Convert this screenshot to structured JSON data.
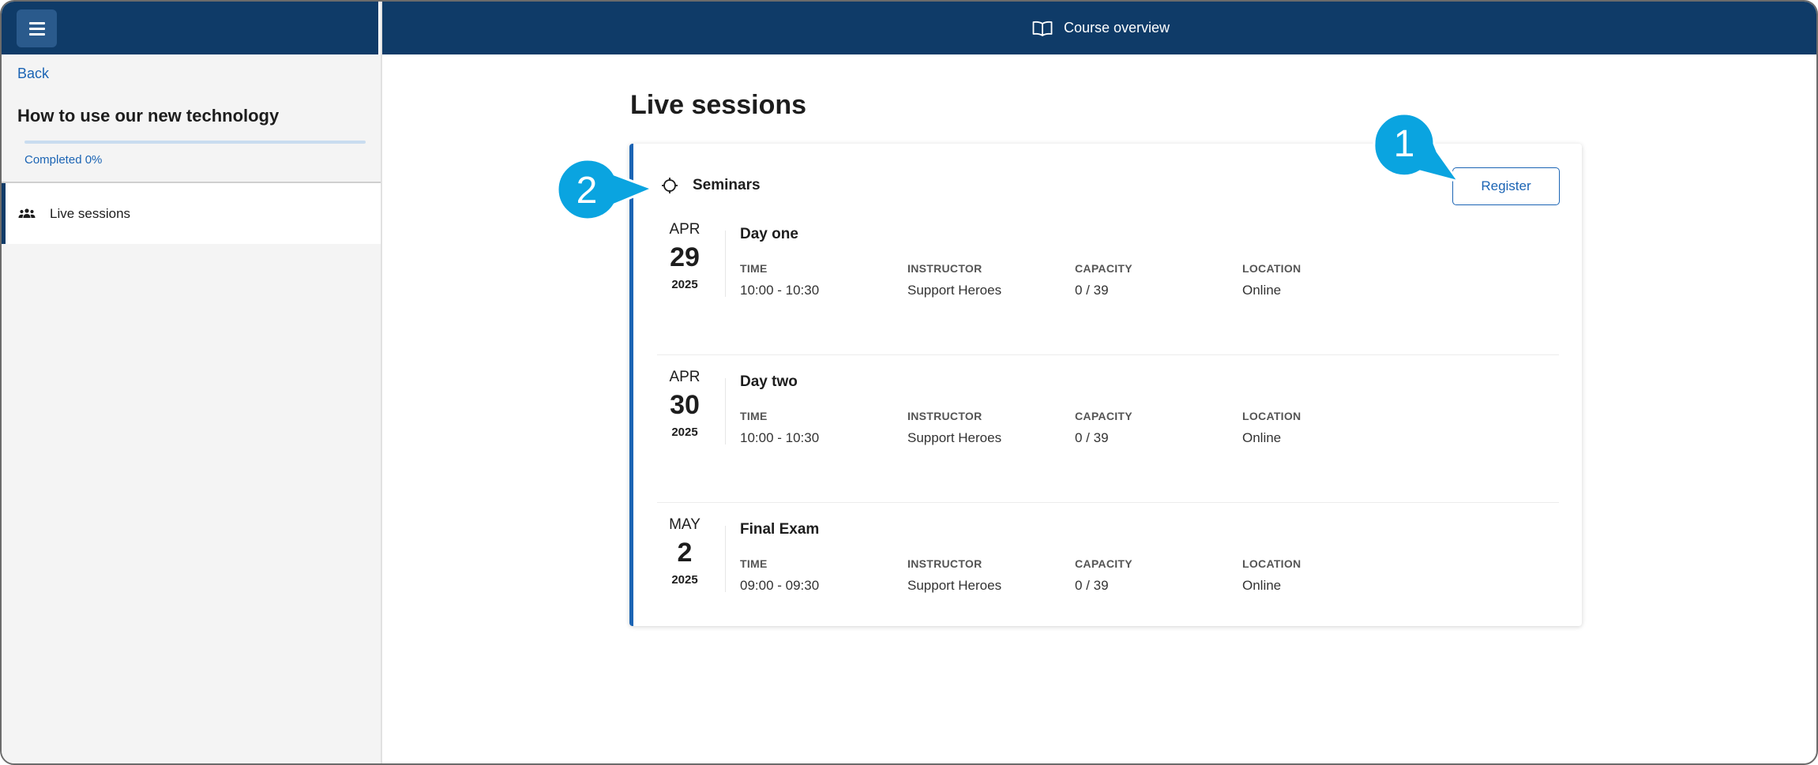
{
  "header": {
    "title": "Course overview"
  },
  "sidebar": {
    "back_label": "Back",
    "course_title": "How to use our new technology",
    "progress_label": "Completed 0%",
    "progress_value": 0,
    "items": [
      {
        "label": "Live sessions",
        "icon": "group-icon",
        "active": true
      }
    ]
  },
  "main": {
    "page_title": "Live sessions",
    "section": {
      "label": "Seminars",
      "icon": "crosshair-icon",
      "register_label": "Register"
    },
    "column_headers": {
      "time": "TIME",
      "instructor": "INSTRUCTOR",
      "capacity": "CAPACITY",
      "location": "LOCATION"
    },
    "sessions": [
      {
        "month": "APR",
        "day": "29",
        "year": "2025",
        "name": "Day one",
        "time": "10:00 - 10:30",
        "instructor": "Support Heroes",
        "capacity": "0 / 39",
        "location": "Online"
      },
      {
        "month": "APR",
        "day": "30",
        "year": "2025",
        "name": "Day two",
        "time": "10:00 - 10:30",
        "instructor": "Support Heroes",
        "capacity": "0 / 39",
        "location": "Online"
      },
      {
        "month": "MAY",
        "day": "2",
        "year": "2025",
        "name": "Final Exam",
        "time": "09:00 - 09:30",
        "instructor": "Support Heroes",
        "capacity": "0 / 39",
        "location": "Online"
      }
    ]
  },
  "callouts": [
    {
      "number": "1"
    },
    {
      "number": "2"
    }
  ],
  "colors": {
    "header_bg": "#0f3b68",
    "accent": "#1b64b4",
    "callout": "#0aa4e0"
  }
}
